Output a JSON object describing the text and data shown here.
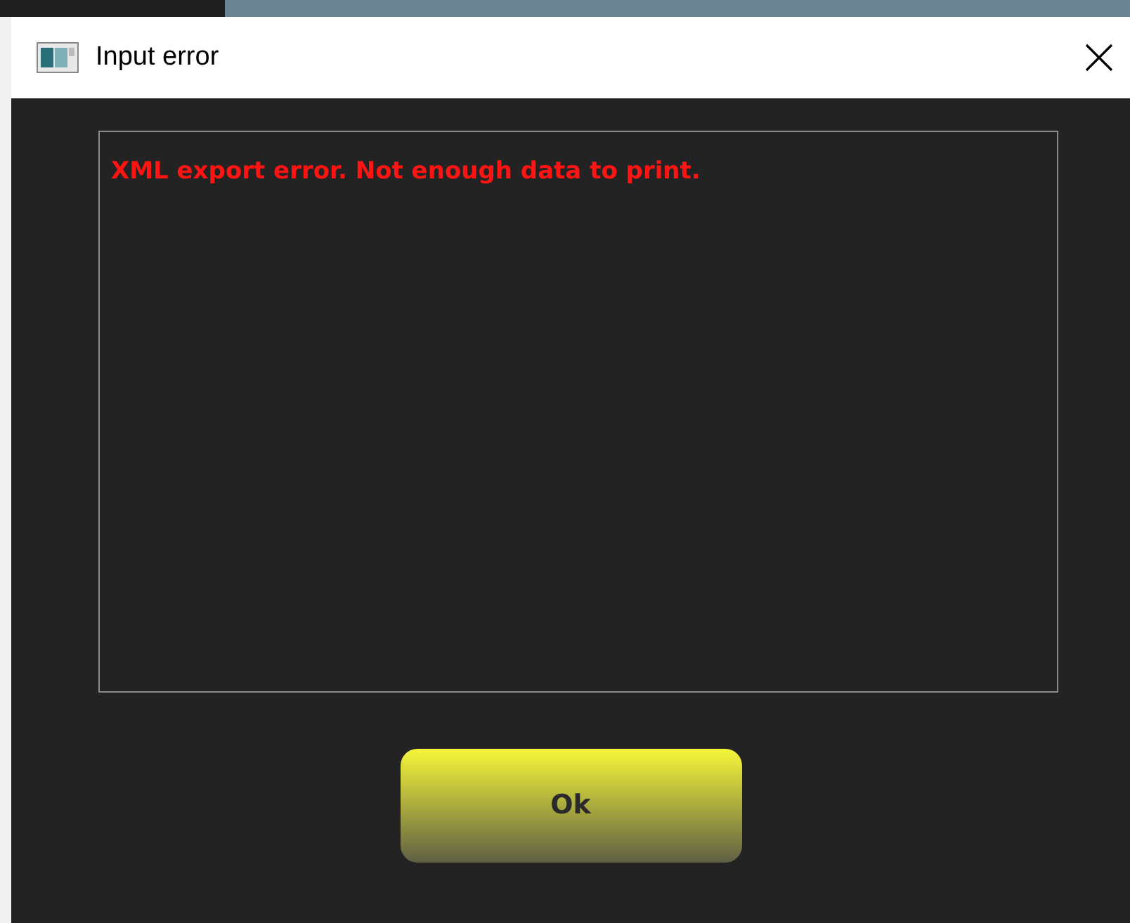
{
  "window": {
    "title": "Input error"
  },
  "message": {
    "text": "XML export error. Not enough data to print."
  },
  "buttons": [
    {
      "label": "Ok"
    }
  ]
}
